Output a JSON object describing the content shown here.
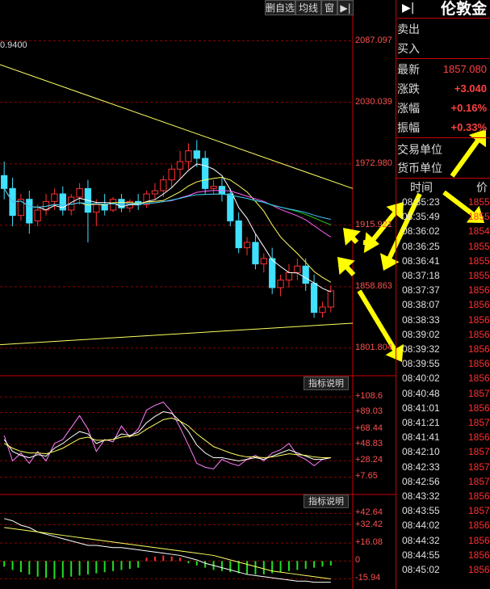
{
  "toolbar": {
    "buttons": [
      "删自选",
      "均线",
      "窗"
    ],
    "arrow_icon": "arrow-right-bar-icon"
  },
  "header": {
    "symbol": "伦敦金",
    "pin_icon": "arrow-right-bar-icon"
  },
  "quote": {
    "sell_label": "卖出",
    "buy_label": "买入",
    "latest_label": "最新",
    "latest_value": "1857.080",
    "change_label": "涨跌",
    "change_value": "+3.040",
    "pct_label": "涨幅",
    "pct_value": "+0.16%",
    "amp_label": "振幅",
    "amp_value": "+0.33%",
    "trade_unit_label": "交易单位",
    "currency_unit_label": "货币单位"
  },
  "ticks": {
    "time_header": "时间",
    "price_header": "价",
    "rows": [
      {
        "time": "08:35:23",
        "price": "1855"
      },
      {
        "time": "08:35:49",
        "price": "1855"
      },
      {
        "time": "08:36:02",
        "price": "1854"
      },
      {
        "time": "08:36:25",
        "price": "1855"
      },
      {
        "time": "08:36:41",
        "price": "1855"
      },
      {
        "time": "08:37:18",
        "price": "1855"
      },
      {
        "time": "08:37:37",
        "price": "1856"
      },
      {
        "time": "08:38:07",
        "price": "1856"
      },
      {
        "time": "08:38:33",
        "price": "1856"
      },
      {
        "time": "08:39:02",
        "price": "1856"
      },
      {
        "time": "08:39:32",
        "price": "1856"
      },
      {
        "time": "08:39:55",
        "price": "1856"
      },
      {
        "time": "08:40:02",
        "price": "1856"
      },
      {
        "time": "08:40:48",
        "price": "1857"
      },
      {
        "time": "08:41:01",
        "price": "1856"
      },
      {
        "time": "08:41:21",
        "price": "1857"
      },
      {
        "time": "08:41:41",
        "price": "1856"
      },
      {
        "time": "08:42:10",
        "price": "1857"
      },
      {
        "time": "08:42:33",
        "price": "1857"
      },
      {
        "time": "08:42:56",
        "price": "1857"
      },
      {
        "time": "08:43:32",
        "price": "1856"
      },
      {
        "time": "08:43:55",
        "price": "1857"
      },
      {
        "time": "08:44:02",
        "price": "1856"
      },
      {
        "time": "08:44:32",
        "price": "1856"
      },
      {
        "time": "08:44:55",
        "price": "1856"
      },
      {
        "time": "08:45:02",
        "price": "1856"
      }
    ]
  },
  "indicator": {
    "button_label": "指标说明",
    "button2_label": "指标说明"
  },
  "colors": {
    "up": "#ff3030",
    "down": "#40e0ff",
    "grid": "#8b0000",
    "annotation": "#ffff00"
  },
  "chart_data": [
    {
      "type": "candlestick",
      "top_left_value": "0.9400",
      "y_ticks": [
        "2087.097",
        "2030.039",
        "1972.980",
        "1915.921",
        "1858.863",
        "1801.804"
      ],
      "ylim": [
        1780,
        2110
      ],
      "candles": [
        {
          "o": 1962,
          "h": 1975,
          "c": 1950,
          "l": 1940
        },
        {
          "o": 1950,
          "h": 1960,
          "c": 1925,
          "l": 1915
        },
        {
          "o": 1925,
          "h": 1945,
          "c": 1940,
          "l": 1920
        },
        {
          "o": 1940,
          "h": 1948,
          "c": 1918,
          "l": 1908
        },
        {
          "o": 1920,
          "h": 1935,
          "c": 1930,
          "l": 1915
        },
        {
          "o": 1930,
          "h": 1945,
          "c": 1938,
          "l": 1925
        },
        {
          "o": 1938,
          "h": 1950,
          "c": 1945,
          "l": 1930
        },
        {
          "o": 1945,
          "h": 1952,
          "c": 1930,
          "l": 1925
        },
        {
          "o": 1930,
          "h": 1945,
          "c": 1942,
          "l": 1925
        },
        {
          "o": 1942,
          "h": 1955,
          "c": 1950,
          "l": 1935
        },
        {
          "o": 1950,
          "h": 1958,
          "c": 1928,
          "l": 1900
        },
        {
          "o": 1928,
          "h": 1940,
          "c": 1935,
          "l": 1915
        },
        {
          "o": 1935,
          "h": 1945,
          "c": 1930,
          "l": 1925
        },
        {
          "o": 1930,
          "h": 1942,
          "c": 1940,
          "l": 1928
        },
        {
          "o": 1940,
          "h": 1945,
          "c": 1932,
          "l": 1928
        },
        {
          "o": 1932,
          "h": 1940,
          "c": 1938,
          "l": 1928
        },
        {
          "o": 1938,
          "h": 1945,
          "c": 1935,
          "l": 1930
        },
        {
          "o": 1935,
          "h": 1948,
          "c": 1945,
          "l": 1932
        },
        {
          "o": 1945,
          "h": 1955,
          "c": 1948,
          "l": 1940
        },
        {
          "o": 1948,
          "h": 1962,
          "c": 1958,
          "l": 1942
        },
        {
          "o": 1958,
          "h": 1972,
          "c": 1968,
          "l": 1950
        },
        {
          "o": 1968,
          "h": 1985,
          "c": 1975,
          "l": 1960
        },
        {
          "o": 1975,
          "h": 1992,
          "c": 1985,
          "l": 1968
        },
        {
          "o": 1985,
          "h": 1995,
          "c": 1978,
          "l": 1970
        },
        {
          "o": 1978,
          "h": 1985,
          "c": 1950,
          "l": 1945
        },
        {
          "o": 1950,
          "h": 1958,
          "c": 1952,
          "l": 1945
        },
        {
          "o": 1952,
          "h": 1960,
          "c": 1945,
          "l": 1938
        },
        {
          "o": 1945,
          "h": 1950,
          "c": 1920,
          "l": 1915
        },
        {
          "o": 1920,
          "h": 1928,
          "c": 1895,
          "l": 1890
        },
        {
          "o": 1895,
          "h": 1905,
          "c": 1900,
          "l": 1888
        },
        {
          "o": 1900,
          "h": 1908,
          "c": 1880,
          "l": 1875
        },
        {
          "o": 1880,
          "h": 1890,
          "c": 1885,
          "l": 1872
        },
        {
          "o": 1885,
          "h": 1895,
          "c": 1858,
          "l": 1852
        },
        {
          "o": 1858,
          "h": 1870,
          "c": 1865,
          "l": 1850
        },
        {
          "o": 1865,
          "h": 1880,
          "c": 1872,
          "l": 1858
        },
        {
          "o": 1872,
          "h": 1885,
          "c": 1878,
          "l": 1865
        },
        {
          "o": 1878,
          "h": 1885,
          "c": 1862,
          "l": 1855
        },
        {
          "o": 1862,
          "h": 1870,
          "c": 1835,
          "l": 1830
        },
        {
          "o": 1835,
          "h": 1845,
          "c": 1840,
          "l": 1830
        },
        {
          "o": 1840,
          "h": 1860,
          "c": 1855,
          "l": 1835
        }
      ]
    },
    {
      "type": "line",
      "name": "indicator-1",
      "y_ticks": [
        "+108.6",
        "+89.03",
        "+68.44",
        "+48.83",
        "+28.24",
        "+7.65"
      ],
      "ylim": [
        0,
        118
      ],
      "series": [
        {
          "color": "#ff80ff",
          "values": [
            60,
            28,
            38,
            25,
            40,
            28,
            50,
            55,
            70,
            85,
            68,
            40,
            55,
            52,
            72,
            58,
            68,
            92,
            98,
            102,
            90,
            70,
            48,
            25,
            20,
            18,
            30,
            25,
            22,
            30,
            35,
            28,
            38,
            42,
            50,
            35,
            30,
            22,
            30,
            32
          ]
        },
        {
          "color": "#ffffff",
          "values": [
            55,
            40,
            35,
            32,
            36,
            34,
            44,
            50,
            58,
            65,
            62,
            50,
            54,
            55,
            62,
            60,
            64,
            76,
            84,
            90,
            88,
            78,
            65,
            48,
            38,
            32,
            32,
            30,
            28,
            30,
            32,
            30,
            34,
            38,
            42,
            38,
            34,
            30,
            30,
            32
          ]
        },
        {
          "color": "#ffff60",
          "values": [
            50,
            44,
            40,
            38,
            38,
            37,
            40,
            44,
            50,
            56,
            58,
            54,
            54,
            55,
            58,
            59,
            61,
            68,
            74,
            80,
            82,
            78,
            72,
            62,
            54,
            46,
            42,
            38,
            35,
            33,
            33,
            32,
            33,
            35,
            37,
            36,
            35,
            33,
            32,
            32
          ]
        }
      ]
    },
    {
      "type": "line",
      "name": "indicator-2",
      "y_ticks": [
        "+42.64",
        "+32.42",
        "+16.08",
        "0",
        "-15.94"
      ],
      "ylim": [
        -20,
        48
      ],
      "series": [
        {
          "color": "#ffffff",
          "values": [
            38,
            36,
            32,
            30,
            26,
            24,
            22,
            20,
            18,
            16,
            14,
            14,
            13,
            12,
            12,
            11,
            10,
            9,
            8,
            7,
            6,
            5,
            3,
            1,
            -2,
            -4,
            -6,
            -8,
            -10,
            -12,
            -13,
            -14,
            -15,
            -16,
            -17,
            -18,
            -18,
            -19,
            -19,
            -19
          ]
        },
        {
          "color": "#ffff60",
          "values": [
            30,
            29,
            28,
            27,
            26,
            25,
            24,
            23,
            22,
            21,
            20,
            19,
            18,
            17,
            16,
            15,
            14,
            13,
            12,
            11,
            10,
            9,
            8,
            7,
            6,
            5,
            3,
            1,
            -1,
            -3,
            -5,
            -7,
            -9,
            -10,
            -11,
            -12,
            -13,
            -14,
            -15,
            -16
          ]
        }
      ],
      "bars": [
        -5,
        -8,
        -10,
        -12,
        -14,
        -15,
        -16,
        -15,
        -14,
        -13,
        -12,
        -11,
        -10,
        -9,
        -8,
        -7,
        -6,
        3,
        4,
        5,
        4,
        3,
        -2,
        -4,
        -6,
        -8,
        -9,
        -10,
        -11,
        -12,
        -12,
        -12,
        -11,
        -10,
        -9,
        -8,
        -7,
        -6,
        -5,
        -4
      ]
    }
  ]
}
